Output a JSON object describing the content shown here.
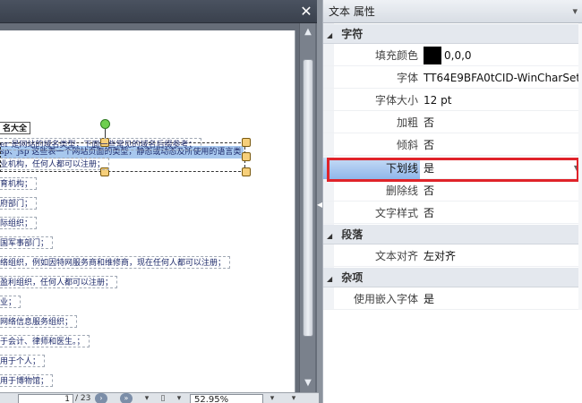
{
  "window": {
    "close_icon": "close-icon"
  },
  "document": {
    "heading": "名大全",
    "selected_line": "sp、jsp 这些表一个网站页面的类型，静态或动态及所使用的语言类",
    "lines": [
      "er 是网站的域名类型，下面一些常见的域名后缀参考：",
      "业机构，任何人都可以注册；",
      "育机构；",
      "府部门；",
      "际组织；",
      "国军事部门；",
      "络组织，例如因特网服务商和维修商，现在任何人都可以注册；",
      "盈利组织，任何人都可以注册；",
      "业；",
      "网络信息服务组织；",
      "于会计、律师和医生。；",
      "用于个人；",
      "用于博物馆；"
    ]
  },
  "statusbar": {
    "page_current": "1",
    "page_total": "/ 23",
    "zoom": "52.95%"
  },
  "properties": {
    "title": "文本 属性",
    "pin_icon": "dropdown-pin-icon",
    "categories": {
      "char": "字符",
      "para": "段落",
      "misc": "杂项"
    },
    "rows": {
      "fill_color_label": "填充颜色",
      "fill_color_value": "0,0,0",
      "font_label": "字体",
      "font_value": "TT64E9BFA0tCID-WinCharSet...",
      "font_size_label": "字体大小",
      "font_size_value": "12 pt",
      "bold_label": "加粗",
      "bold_value": "否",
      "italic_label": "倾斜",
      "italic_value": "否",
      "underline_label": "下划线",
      "underline_value": "是",
      "strike_label": "删除线",
      "strike_value": "否",
      "textstyle_label": "文字样式",
      "textstyle_value": "否",
      "align_label": "文本对齐",
      "align_value": "左对齐",
      "embed_label": "使用嵌入字体",
      "embed_value": "是"
    },
    "colors": {
      "fill": "#000000",
      "highlight_border": "#e0232a",
      "selection": "#8fb6ea"
    }
  }
}
